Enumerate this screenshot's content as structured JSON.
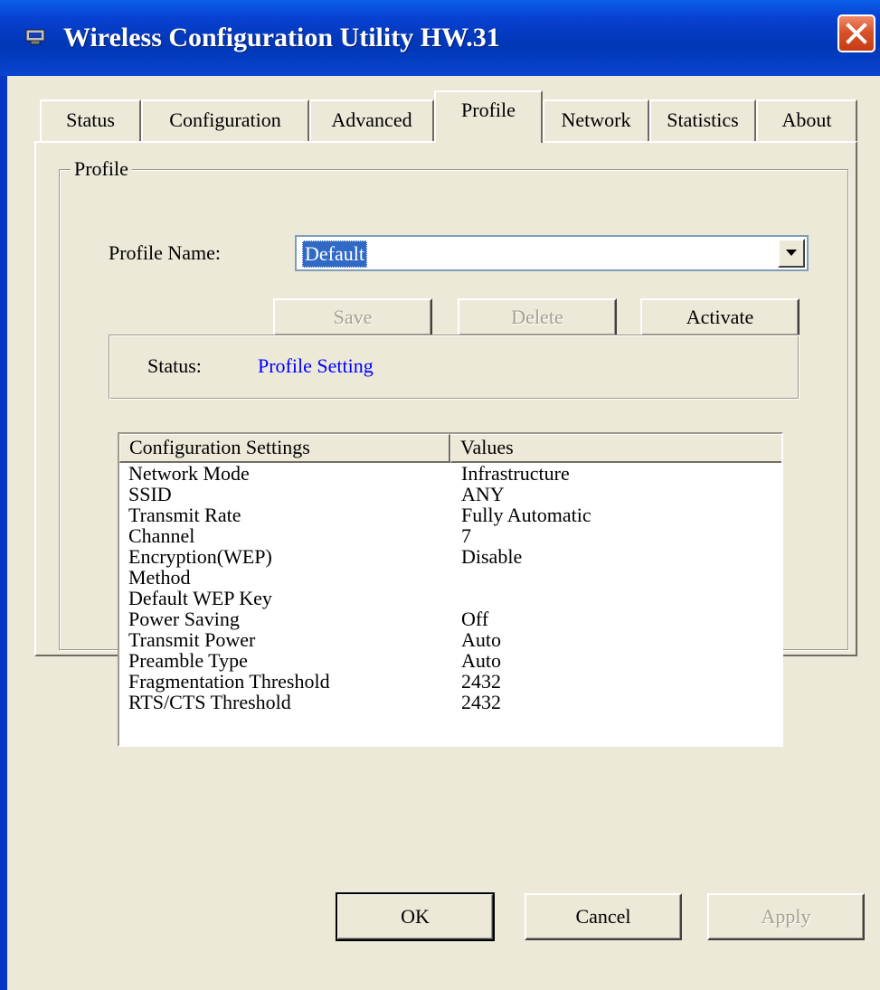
{
  "window": {
    "title": "Wireless Configuration Utility HW.31",
    "title_icon": "network-adapter-icon"
  },
  "tabs": [
    {
      "label": "Status",
      "active": false
    },
    {
      "label": "Configuration",
      "active": false
    },
    {
      "label": "Advanced",
      "active": false
    },
    {
      "label": "Profile",
      "active": true
    },
    {
      "label": "Network",
      "active": false
    },
    {
      "label": "Statistics",
      "active": false
    },
    {
      "label": "About",
      "active": false
    }
  ],
  "profile": {
    "group_title": "Profile",
    "name_label": "Profile Name:",
    "name_value": "Default",
    "buttons": {
      "save": "Save",
      "delete": "Delete",
      "activate": "Activate"
    },
    "status_label": "Status:",
    "status_value": "Profile Setting",
    "status_color": "#0000ff"
  },
  "settings_table": {
    "columns": [
      "Configuration Settings",
      "Values"
    ],
    "rows": [
      [
        "Network Mode",
        "Infrastructure"
      ],
      [
        "SSID",
        "ANY"
      ],
      [
        "Transmit Rate",
        "Fully Automatic"
      ],
      [
        "Channel",
        "7"
      ],
      [
        "Encryption(WEP)",
        "Disable"
      ],
      [
        "Method",
        ""
      ],
      [
        "Default WEP Key",
        ""
      ],
      [
        "Power Saving",
        "Off"
      ],
      [
        "Transmit Power",
        "Auto"
      ],
      [
        "Preamble Type",
        "Auto"
      ],
      [
        "Fragmentation Threshold",
        "2432"
      ],
      [
        "RTS/CTS Threshold",
        "2432"
      ]
    ]
  },
  "dialog_buttons": {
    "ok": "OK",
    "cancel": "Cancel",
    "apply": "Apply"
  },
  "colors": {
    "titlebar": "#0037b6",
    "selection": "#316ac5",
    "face": "#ece9d8"
  }
}
